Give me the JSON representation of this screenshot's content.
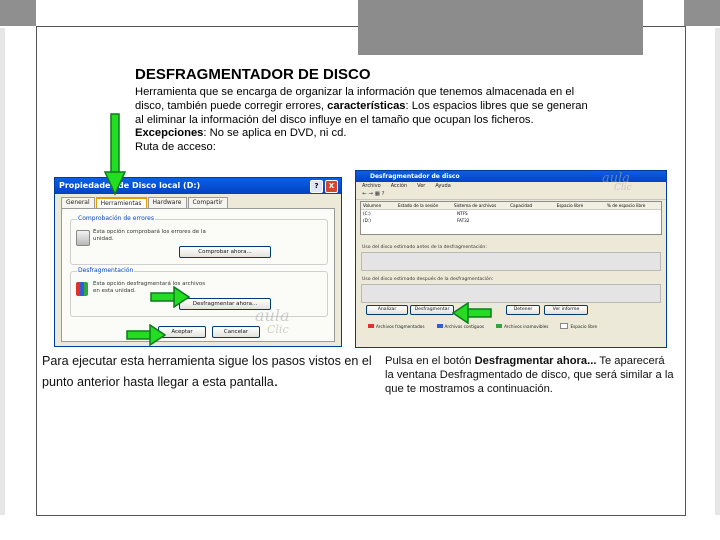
{
  "slide": {
    "title": "DESFRAGMENTADOR DE DISCO",
    "description": {
      "line1_a": "Herramienta que se encarga de organizar la información que tenemos almacenada en el disco, también puede corregir errores, ",
      "line1_b": "características",
      "line1_c": ": Los espacios libres que se generan al eliminar la información del disco influye en el tamaño que ocupan los ficheros.",
      "exceptions_label": "Excepciones",
      "exceptions_text": ": No se aplica en DVD, ni cd.",
      "access_path": "Ruta de acceso:"
    },
    "caption_left": "Para ejecutar esta herramienta sigue los pasos vistos en el punto anterior hasta llegar a esta pantalla",
    "caption_left_dot": ".",
    "caption_right_a": "Pulsa en el botón ",
    "caption_right_bold": "Desfragmentar ahora...",
    "caption_right_b": " Te aparecerá la ventana Desfragmentado de disco, que será similar a la que te mostramos a continuación."
  },
  "properties_dialog": {
    "title": "Propiedades de Disco local (D:)",
    "tabs": [
      "General",
      "Herramientas",
      "Hardware",
      "Compartir"
    ],
    "group_check_label": "Comprobación de errores",
    "group_check_text": "Esta opción comprobará los errores de la unidad.",
    "group_check_button": "Comprobar ahora...",
    "group_defrag_label": "Desfragmentación",
    "group_defrag_text": "Esta opción desfragmentará los archivos en esta unidad.",
    "group_defrag_button": "Desfragmentar ahora...",
    "ok_button": "Aceptar",
    "cancel_button": "Cancelar",
    "help_symbol": "?",
    "close_symbol": "X"
  },
  "defrag_window": {
    "title": "Desfragmentador de disco",
    "menu": [
      "Archivo",
      "Acción",
      "Ver",
      "Ayuda"
    ],
    "toolbar": "← → ▦ ?",
    "columns": [
      "Volumen",
      "Estado de la sesión",
      "Sistema de archivos",
      "Capacidad",
      "Espacio libre",
      "% de espacio libre"
    ],
    "rows": [
      [
        "(C:)",
        "",
        "NTFS",
        "",
        "",
        ""
      ],
      [
        "(D:)",
        "",
        "FAT32",
        "",
        "",
        ""
      ]
    ],
    "label_before": "Uso del disco estimado antes de la desfragmentación:",
    "label_after": "Uso del disco estimado después de la desfragmentación:",
    "buttons": [
      "Analizar",
      "Desfragmentar",
      "Detener",
      "Ver informe"
    ],
    "legend": [
      {
        "label": "Archivos fragmentados",
        "color": "#e0312a"
      },
      {
        "label": "Archivos contiguos",
        "color": "#2f5fd6"
      },
      {
        "label": "Archivos inamovibles",
        "color": "#2ea73c"
      },
      {
        "label": "Espacio libre",
        "color": "#ffffff"
      }
    ]
  },
  "watermarks": [
    "aula",
    "Clic"
  ],
  "colors": {
    "arrow_green": "#22dd22",
    "arrow_dark": "#0e7a1c",
    "frame_grey": "#8c8c8c"
  }
}
